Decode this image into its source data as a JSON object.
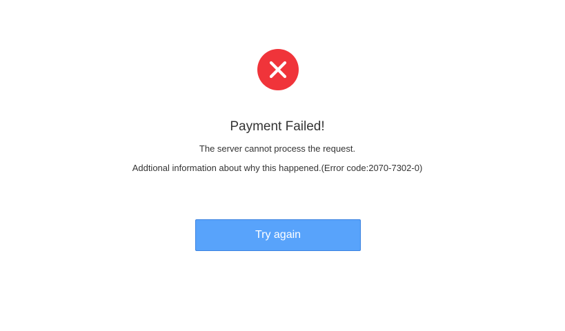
{
  "colors": {
    "error": "#f0343a",
    "button_bg": "#58a3fb",
    "text": "#333333"
  },
  "status": {
    "icon": "x-close-icon"
  },
  "title": "Payment Failed!",
  "message": "The server cannot process the request.",
  "details": "Addtional information about why this happened.(Error code:2070-7302-0)",
  "button": {
    "label": "Try again"
  }
}
